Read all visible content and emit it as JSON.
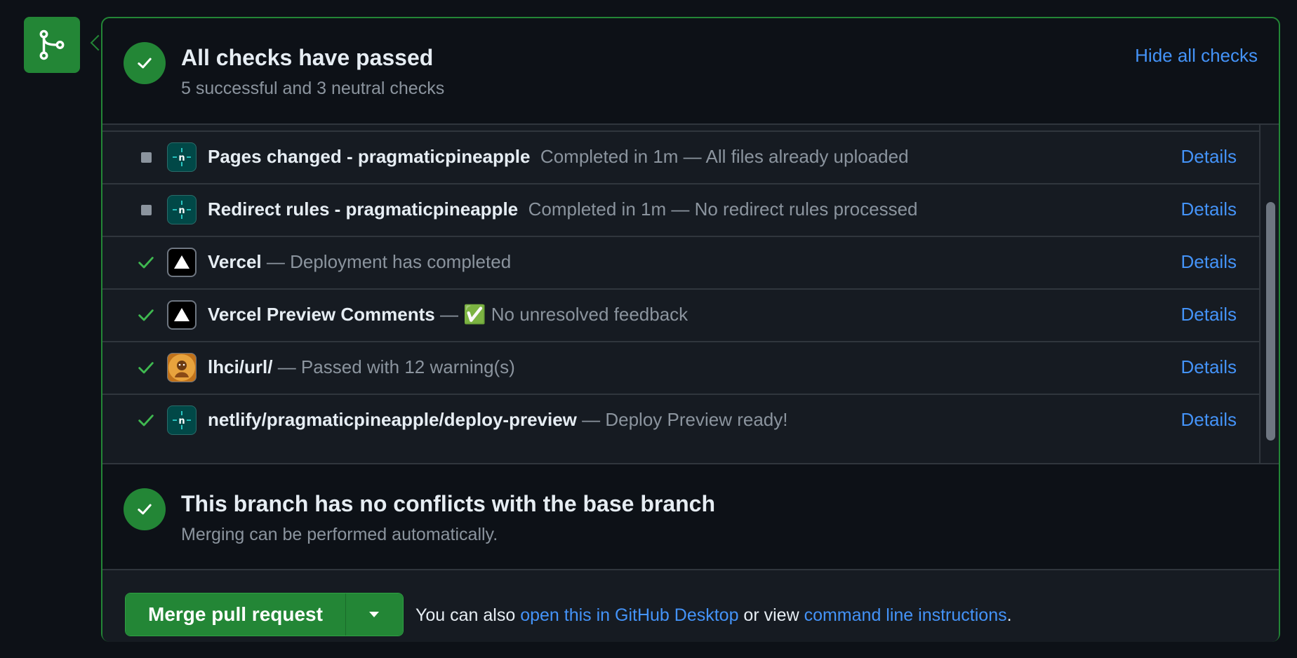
{
  "header": {
    "title": "All checks have passed",
    "subtitle": "5 successful and 3 neutral checks",
    "hide_link": "Hide all checks"
  },
  "checks": [
    {
      "status": "neutral",
      "icon": "netlify-icon",
      "name": "Pages changed - pragmaticpineapple",
      "description": "Completed in 1m — All files already uploaded",
      "details": "Details"
    },
    {
      "status": "neutral",
      "icon": "netlify-icon",
      "name": "Redirect rules - pragmaticpineapple",
      "description": "Completed in 1m — No redirect rules processed",
      "details": "Details"
    },
    {
      "status": "success",
      "icon": "vercel-icon",
      "name": "Vercel",
      "description": "— Deployment has completed",
      "details": "Details"
    },
    {
      "status": "success",
      "icon": "vercel-icon",
      "name": "Vercel Preview Comments",
      "description": "— ✅ No unresolved feedback",
      "details": "Details"
    },
    {
      "status": "success",
      "icon": "lhci-icon",
      "name": "lhci/url/",
      "description": "— Passed with 12 warning(s)",
      "details": "Details"
    },
    {
      "status": "success",
      "icon": "netlify-icon",
      "name": "netlify/pragmaticpineapple/deploy-preview",
      "description": "— Deploy Preview ready!",
      "details": "Details"
    }
  ],
  "conflicts": {
    "title": "This branch has no conflicts with the base branch",
    "subtitle": "Merging can be performed automatically."
  },
  "footer": {
    "merge_label": "Merge pull request",
    "text_before": "You can also ",
    "desktop_link": "open this in GitHub Desktop",
    "text_middle": " or view ",
    "cli_link": "command line instructions",
    "text_after": "."
  },
  "colors": {
    "success": "#238636",
    "link": "#4493f8",
    "background": "#0d1117",
    "muted": "#8b949e"
  }
}
